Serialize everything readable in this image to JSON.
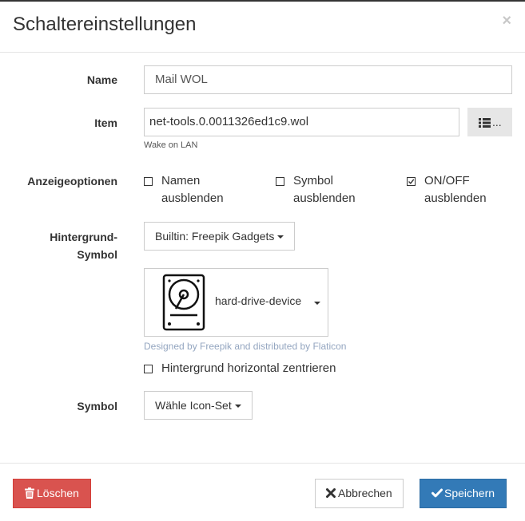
{
  "dialog": {
    "title": "Schaltereinstellungen",
    "close_glyph": "×"
  },
  "form": {
    "name": {
      "label": "Name",
      "value": "Mail WOL"
    },
    "item": {
      "label": "Item",
      "value": "net-tools.0.0011326ed1c9.wol",
      "hint": "Wake on LAN",
      "list_button_icon": "list-icon",
      "list_button_suffix": "..."
    },
    "display_options": {
      "label": "Anzeigeoptionen",
      "options": [
        {
          "line1": "Namen",
          "line2": "ausblenden",
          "checked": false
        },
        {
          "line1": "Symbol",
          "line2": "ausblenden",
          "checked": false
        },
        {
          "line1": "ON/OFF",
          "line2": "ausblenden",
          "checked": true
        }
      ]
    },
    "background_symbol": {
      "label_line1": "Hintergrund-",
      "label_line2": "Symbol",
      "set_dropdown": "Builtin: Freepik Gadgets",
      "icon_name": "hard-drive-device",
      "icon": "hard-drive-icon",
      "credit": "Designed by Freepik and distributed by Flaticon",
      "center_label": "Hintergrund horizontal zentrieren",
      "center_checked": false
    },
    "symbol": {
      "label": "Symbol",
      "dropdown": "Wähle Icon-Set"
    }
  },
  "footer": {
    "delete_label": "Löschen",
    "delete_icon": "trash-icon",
    "cancel_label": "Abbrechen",
    "cancel_icon": "x-icon",
    "save_label": "Speichern",
    "save_icon": "check-icon"
  },
  "colors": {
    "danger": "#d9534f",
    "primary": "#337ab7",
    "credit": "#94a6c0"
  }
}
